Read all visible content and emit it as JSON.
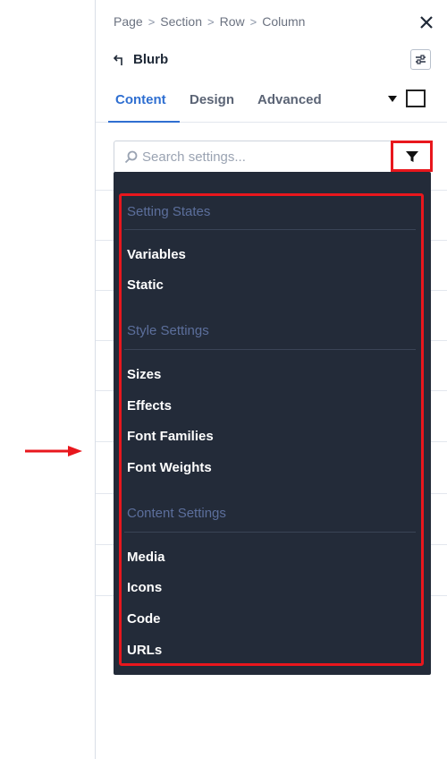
{
  "breadcrumb": [
    "Page",
    "Section",
    "Row",
    "Column"
  ],
  "header": {
    "title": "Blurb"
  },
  "tabs": [
    {
      "label": "Content",
      "active": true
    },
    {
      "label": "Design",
      "active": false
    },
    {
      "label": "Advanced",
      "active": false
    }
  ],
  "search": {
    "placeholder": "Search settings...",
    "value": ""
  },
  "filter_menu": {
    "groups": [
      {
        "header": "Setting States",
        "items": [
          "Variables",
          "Static"
        ]
      },
      {
        "header": "Style Settings",
        "items": [
          "Sizes",
          "Effects",
          "Font Families",
          "Font Weights"
        ]
      },
      {
        "header": "Content Settings",
        "items": [
          "Media",
          "Icons",
          "Code",
          "URLs"
        ]
      }
    ]
  },
  "colors": {
    "accent": "#2f6fd1",
    "highlight": "#e8171d",
    "menu_bg": "#232b39",
    "menu_header": "#5c6f9c"
  }
}
